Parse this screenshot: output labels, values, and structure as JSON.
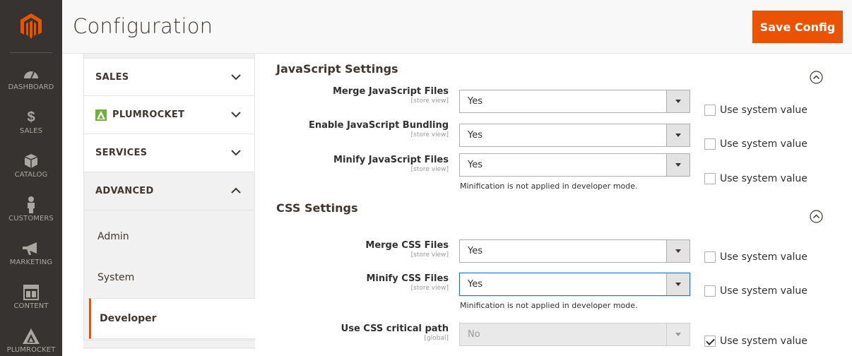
{
  "header": {
    "title": "Configuration",
    "save_label": "Save Config"
  },
  "admin_nav": [
    {
      "label": "DASHBOARD",
      "icon": "dashboard-icon"
    },
    {
      "label": "SALES",
      "icon": "dollar-icon"
    },
    {
      "label": "CATALOG",
      "icon": "box-icon"
    },
    {
      "label": "CUSTOMERS",
      "icon": "person-icon"
    },
    {
      "label": "MARKETING",
      "icon": "megaphone-icon"
    },
    {
      "label": "CONTENT",
      "icon": "layout-icon"
    },
    {
      "label": "PLUMROCKET",
      "icon": "plumrocket-icon"
    }
  ],
  "config_tabs": [
    {
      "label": "SALES"
    },
    {
      "label": "PLUMROCKET"
    },
    {
      "label": "SERVICES"
    },
    {
      "label": "ADVANCED"
    }
  ],
  "advanced_items": [
    {
      "label": "Admin"
    },
    {
      "label": "System"
    },
    {
      "label": "Developer"
    }
  ],
  "sections": {
    "js": {
      "title": "JavaScript Settings",
      "rows": [
        {
          "label": "Merge JavaScript Files",
          "scope": "[store view]",
          "value": "Yes",
          "system": "Use system value"
        },
        {
          "label": "Enable JavaScript Bundling",
          "scope": "[store view]",
          "value": "Yes",
          "system": "Use system value"
        },
        {
          "label": "Minify JavaScript Files",
          "scope": "[store view]",
          "value": "Yes",
          "system": "Use system value",
          "note": "Minification is not applied in developer mode."
        }
      ]
    },
    "css": {
      "title": "CSS Settings",
      "rows": [
        {
          "label": "Merge CSS Files",
          "scope": "[store view]",
          "value": "Yes",
          "system": "Use system value"
        },
        {
          "label": "Minify CSS Files",
          "scope": "[store view]",
          "value": "Yes",
          "system": "Use system value",
          "note": "Minification is not applied in developer mode."
        },
        {
          "label": "Use CSS critical path",
          "scope": "[global]",
          "value": "No",
          "system": "Use system value"
        }
      ]
    }
  },
  "colors": {
    "accent": "#eb5202",
    "nav_bg": "#373330"
  }
}
